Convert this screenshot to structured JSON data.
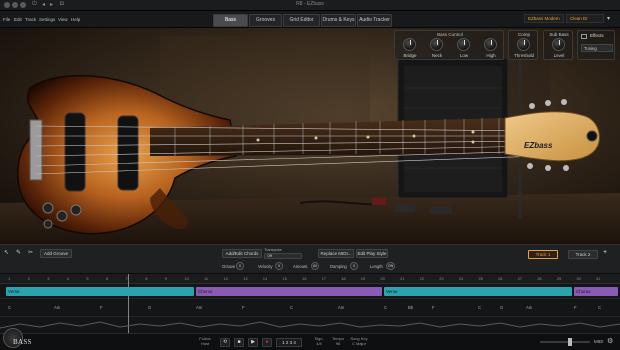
{
  "window": {
    "title": "R8 - EZbass"
  },
  "menu": [
    "File",
    "Edit",
    "Track",
    "Settings",
    "View",
    "Help"
  ],
  "tabs": [
    {
      "label": "Bass",
      "active": true
    },
    {
      "label": "Grooves",
      "active": false
    },
    {
      "label": "Grid Editor",
      "active": false
    },
    {
      "label": "Drums & Keys",
      "active": false
    },
    {
      "label": "Audio Tracker",
      "active": false
    }
  ],
  "presets": {
    "bass_model": "EZbass Modern",
    "preset": "Clean DI"
  },
  "controls": {
    "bass_control_title": "Bass Control",
    "knobs": [
      "Bridge",
      "Neck",
      "Low",
      "High"
    ],
    "comp_title": "Comp",
    "comp_knob": "Threshold",
    "sub_bass_title": "Sub Bass",
    "sub_bass_knob": "Level",
    "effects_label": "Effects",
    "tuning_label": "Tuning"
  },
  "headstock_brand": "EZbass",
  "toolbar": {
    "add_groove": "Add Groove",
    "add_edit_chords": "Add/Edit Chords",
    "transpose_label": "Transpose",
    "transpose_value": "Off",
    "replace_midi": "Replace MIDI...",
    "edit_play_style": "Edit Play Style",
    "octave_label": "Octave",
    "octave_value": "0",
    "velocity_label": "Velocity",
    "velocity_value": "0",
    "amount_label": "Amount",
    "amount_value": "60",
    "damping_label": "Damping",
    "damping_value": "0",
    "length_label": "Length",
    "length_value": "ON",
    "track1": "Track 1",
    "track2": "Track 2",
    "add_track": "+"
  },
  "ruler": [
    "1",
    "2",
    "3",
    "4",
    "5",
    "6",
    "7",
    "8",
    "9",
    "10",
    "11",
    "12",
    "13",
    "14",
    "15",
    "16",
    "17",
    "18",
    "19",
    "20",
    "21",
    "22",
    "23",
    "24",
    "25",
    "26",
    "27",
    "28",
    "29",
    "30",
    "31"
  ],
  "sections": [
    {
      "label": "Verse",
      "color": "#2aa3ad"
    },
    {
      "label": "Chorus",
      "color": "#8a5ab5"
    },
    {
      "label": "Verse",
      "color": "#2aa3ad"
    },
    {
      "label": "Chorus",
      "color": "#8a5ab5"
    }
  ],
  "chords": [
    "C",
    "Am",
    "F",
    "G",
    "Am",
    "F",
    "C",
    "Am",
    "C",
    "Bb",
    "F",
    "C",
    "G",
    "Am",
    "F",
    "C"
  ],
  "transport": {
    "follow_host": "Follow Host",
    "time": "1 2 3 4",
    "sign_label": "Sign.",
    "sign_value": "4/4",
    "tempo_label": "Tempo",
    "tempo_value": "96",
    "song_key_label": "Song Key",
    "song_key_value": "C Major",
    "midi_label": "MIDI"
  },
  "logo": {
    "text": "BASS"
  }
}
